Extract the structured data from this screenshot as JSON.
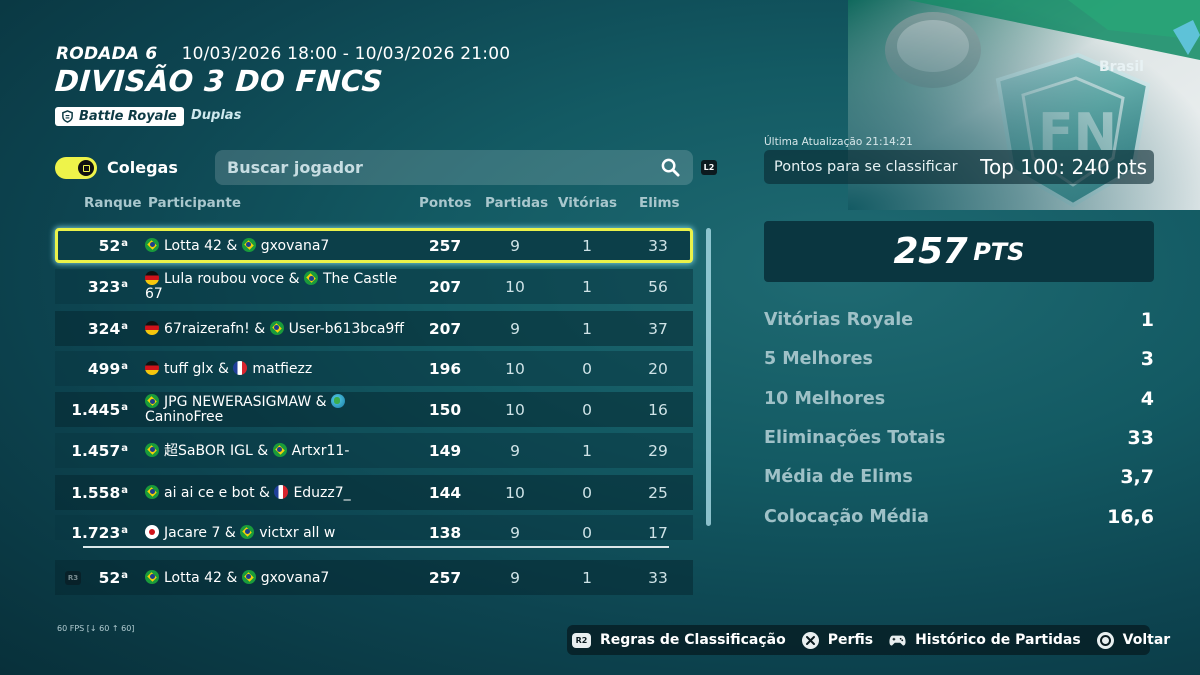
{
  "header": {
    "round": "RODADA 6",
    "dates": "10/03/2026 18:00 - 10/03/2026 21:00",
    "title": "DIVISÃO 3 DO FNCS",
    "mode": "Battle Royale",
    "team_type": "Duplas"
  },
  "controls": {
    "toggle_label": "Colegas",
    "toggle_on": true,
    "search_placeholder": "Buscar jogador",
    "search_button_hint": "L2"
  },
  "columns": {
    "rank": "Ranque",
    "participant": "Participante",
    "points": "Pontos",
    "matches": "Partidas",
    "wins": "Vitórias",
    "elims": "Elims"
  },
  "rows": [
    {
      "rank": "52",
      "sup": "a",
      "flag1": "br",
      "p1": "Lotta 42",
      "flag2": "br",
      "p2": "gxovana7",
      "points": "257",
      "matches": "9",
      "wins": "1",
      "elims": "33"
    },
    {
      "rank": "323",
      "sup": "a",
      "flag1": "de",
      "p1": "Lula roubou voce",
      "flag2": "br",
      "p2": "The Castle 67",
      "points": "207",
      "matches": "10",
      "wins": "1",
      "elims": "56"
    },
    {
      "rank": "324",
      "sup": "a",
      "flag1": "de",
      "p1": "67raizerafn!",
      "flag2": "br",
      "p2": "User-b613bca9ff",
      "points": "207",
      "matches": "9",
      "wins": "1",
      "elims": "37"
    },
    {
      "rank": "499",
      "sup": "a",
      "flag1": "de",
      "p1": "tuff glx",
      "flag2": "fr",
      "p2": "matfiezz",
      "points": "196",
      "matches": "10",
      "wins": "0",
      "elims": "20"
    },
    {
      "rank": "1.445",
      "sup": "a",
      "flag1": "br",
      "p1": "JPG NEWERASIGMAW",
      "flag2": "globe",
      "p2": "CaninoFree",
      "points": "150",
      "matches": "10",
      "wins": "0",
      "elims": "16"
    },
    {
      "rank": "1.457",
      "sup": "a",
      "flag1": "br",
      "p1": "超SaBOR IGL",
      "flag2": "br",
      "p2": "Artxr11-",
      "points": "149",
      "matches": "9",
      "wins": "1",
      "elims": "29"
    },
    {
      "rank": "1.558",
      "sup": "a",
      "flag1": "br",
      "p1": "ai ai ce e bot",
      "flag2": "fr",
      "p2": "Eduzz7_",
      "points": "144",
      "matches": "10",
      "wins": "0",
      "elims": "25"
    },
    {
      "rank": "1.723",
      "sup": "a",
      "flag1": "jp",
      "p1": "Jacare 7",
      "flag2": "br",
      "p2": "victxr all w",
      "points": "138",
      "matches": "9",
      "wins": "0",
      "elims": "17"
    }
  ],
  "pinned_row": {
    "rank": "52",
    "sup": "a",
    "p1": "Lotta 42",
    "p2": "gxovana7",
    "points": "257",
    "matches": "9",
    "wins": "1",
    "elims": "33",
    "button_hint": "R3"
  },
  "right_panel": {
    "region": "Brasil",
    "last_update": "Última Atualização 21:14:21",
    "qualify_label": "Pontos para se classificar",
    "qualify_value": "Top 100: 240 pts",
    "total_points": "257",
    "points_unit": "PTS",
    "stats": [
      {
        "label": "Vitórias Royale",
        "value": "1"
      },
      {
        "label": "5 Melhores",
        "value": "3"
      },
      {
        "label": "10 Melhores",
        "value": "4"
      },
      {
        "label": "Eliminações Totais",
        "value": "33"
      },
      {
        "label": "Média de Elims",
        "value": "3,7"
      },
      {
        "label": "Colocação Média",
        "value": "16,6"
      }
    ]
  },
  "footer": {
    "fps": "60 FPS [↓ 60 ↑ 60]",
    "hints": [
      {
        "button": "R2",
        "label": "Regras de Classificação"
      },
      {
        "button": "cross",
        "label": "Perfis"
      },
      {
        "button": "gamepad",
        "label": "Histórico de Partidas"
      },
      {
        "button": "circle",
        "label": "Voltar"
      }
    ]
  },
  "colors": {
    "accent": "#eaf24a",
    "background": "#135a63"
  }
}
